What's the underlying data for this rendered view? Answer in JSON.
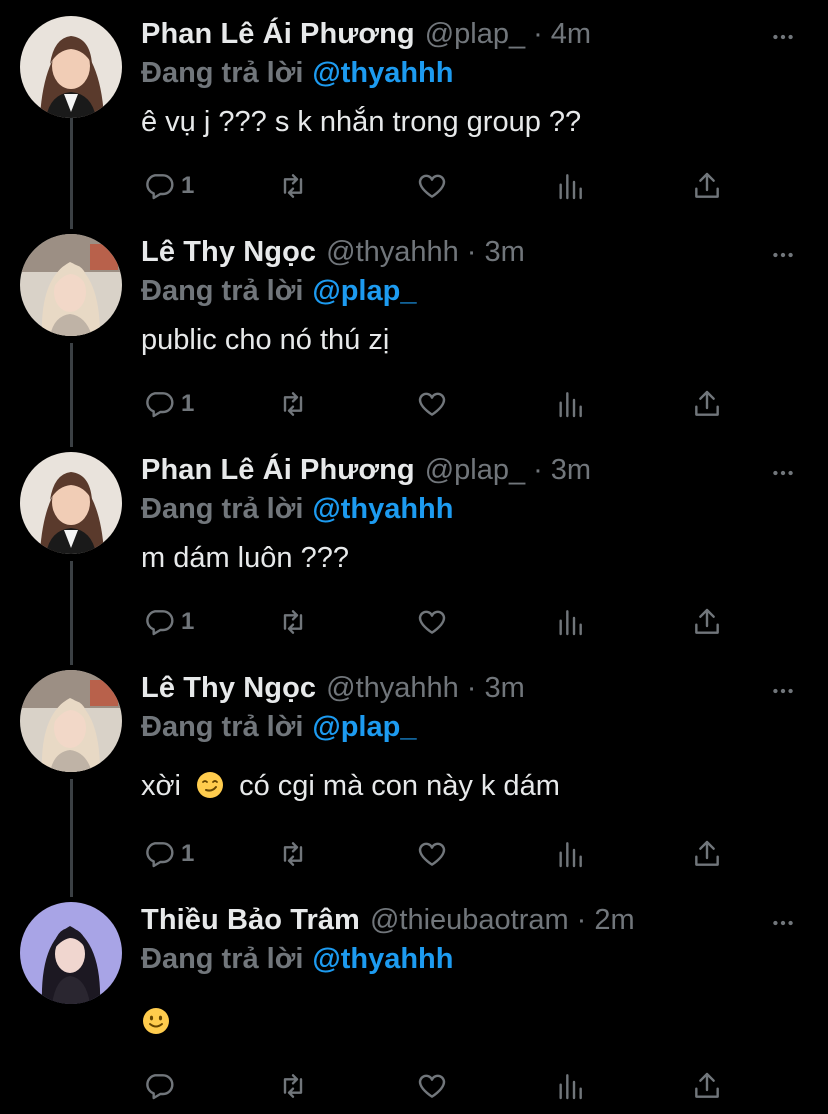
{
  "tweets": [
    {
      "name": "Phan Lê Ái Phương",
      "handle": "@plap_",
      "separator": "·",
      "time": "4m",
      "replying_label": "Đang trả lời",
      "replying_to": "@thyahhh",
      "text": "ê vụ j ??? s k nhắn trong group ??",
      "reply_count": "1",
      "avatar": "woman-portrait-avatar"
    },
    {
      "name": "Lê Thy Ngọc",
      "handle": "@thyahhh",
      "separator": "·",
      "time": "3m",
      "replying_label": "Đang trả lời",
      "replying_to": "@plap_",
      "text": "public cho nó thú zị",
      "reply_count": "1",
      "avatar": "blonde-selfie-avatar"
    },
    {
      "name": "Phan Lê Ái Phương",
      "handle": "@plap_",
      "separator": "·",
      "time": "3m",
      "replying_label": "Đang trả lời",
      "replying_to": "@thyahhh",
      "text": "m dám luôn ???",
      "reply_count": "1",
      "avatar": "woman-portrait-avatar"
    },
    {
      "name": "Lê Thy Ngọc",
      "handle": "@thyahhh",
      "separator": "·",
      "time": "3m",
      "replying_label": "Đang trả lời",
      "replying_to": "@plap_",
      "text_before": "xời",
      "text_after": "có cgi mà con này k dám",
      "emoji": "smirking-face-emoji",
      "reply_count": "1",
      "avatar": "blonde-selfie-avatar"
    },
    {
      "name": "Thiều Bảo Trâm",
      "handle": "@thieubaotram",
      "separator": "·",
      "time": "2m",
      "replying_label": "Đang trả lời",
      "replying_to": "@thyahhh",
      "emoji": "slightly-smiling-face-emoji",
      "reply_count": "",
      "avatar": "dark-hair-purple-avatar"
    }
  ],
  "icons": {
    "more": "more-dots-icon",
    "reply": "reply-icon",
    "retweet": "retweet-icon",
    "like": "heart-icon",
    "views": "analytics-icon",
    "share": "share-icon"
  },
  "colors": {
    "background": "#000000",
    "text": "#e7e9ea",
    "secondary": "#71767b",
    "accent": "#1d9bf0",
    "thread_line": "#3b4044"
  }
}
